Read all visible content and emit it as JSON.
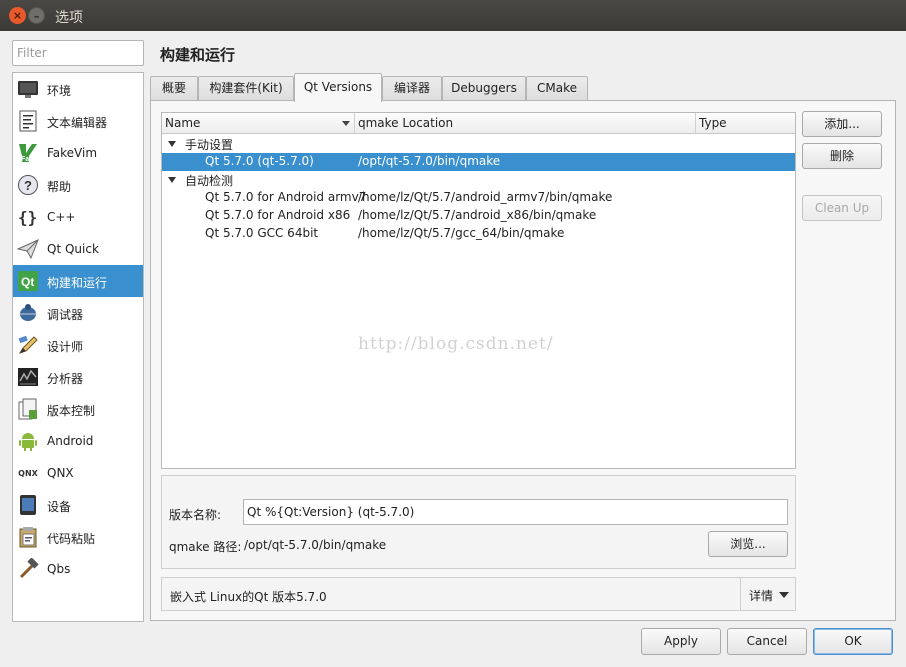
{
  "window": {
    "title": "选项",
    "close_glyph": "×",
    "minimize_glyph": "–"
  },
  "sidebar": {
    "filter_placeholder": "Filter",
    "items": [
      {
        "label": "环境",
        "icon": "monitor-icon"
      },
      {
        "label": "文本编辑器",
        "icon": "text-editor-icon"
      },
      {
        "label": "FakeVim",
        "icon": "fakevim-icon"
      },
      {
        "label": "帮助",
        "icon": "help-icon"
      },
      {
        "label": "C++",
        "icon": "braces-icon"
      },
      {
        "label": "Qt Quick",
        "icon": "paper-plane-icon"
      },
      {
        "label": "构建和运行",
        "icon": "qt-build-icon",
        "selected": true
      },
      {
        "label": "调试器",
        "icon": "bug-icon"
      },
      {
        "label": "设计师",
        "icon": "pencil-icon"
      },
      {
        "label": "分析器",
        "icon": "analyzer-icon"
      },
      {
        "label": "版本控制",
        "icon": "version-control-icon"
      },
      {
        "label": "Android",
        "icon": "android-icon"
      },
      {
        "label": "QNX",
        "icon": "qnx-icon"
      },
      {
        "label": "设备",
        "icon": "device-icon"
      },
      {
        "label": "代码粘贴",
        "icon": "code-paste-icon"
      },
      {
        "label": "Qbs",
        "icon": "hammer-icon"
      }
    ]
  },
  "main": {
    "page_title": "构建和运行",
    "tabs": [
      {
        "label": "概要"
      },
      {
        "label": "构建套件(Kit)"
      },
      {
        "label": "Qt Versions",
        "active": true
      },
      {
        "label": "编译器"
      },
      {
        "label": "Debuggers"
      },
      {
        "label": "CMake"
      }
    ],
    "table": {
      "columns": [
        "Name",
        "qmake Location",
        "Type"
      ],
      "groups": [
        {
          "label": "手动设置",
          "rows": [
            {
              "name": "Qt 5.7.0 (qt-5.7.0)",
              "location": "/opt/qt-5.7.0/bin/qmake",
              "type": "",
              "selected": true
            }
          ]
        },
        {
          "label": "自动检测",
          "rows": [
            {
              "name": "Qt 5.7.0 for Android armv7",
              "location": "/home/lz/Qt/5.7/android_armv7/bin/qmake",
              "type": ""
            },
            {
              "name": "Qt 5.7.0 for Android x86",
              "location": "/home/lz/Qt/5.7/android_x86/bin/qmake",
              "type": ""
            },
            {
              "name": "Qt 5.7.0 GCC 64bit",
              "location": "/home/lz/Qt/5.7/gcc_64/bin/qmake",
              "type": ""
            }
          ]
        }
      ]
    },
    "buttons": {
      "add": "添加...",
      "remove": "删除",
      "cleanup": "Clean Up"
    },
    "watermark": "http://blog.csdn.net/",
    "details": {
      "version_name_label": "版本名称:",
      "version_name_value": "Qt %{Qt:Version} (qt-5.7.0)",
      "qmake_path_label": "qmake 路径:",
      "qmake_path_value": "/opt/qt-5.7.0/bin/qmake",
      "browse_button": "浏览...",
      "info_text": "嵌入式 Linux的Qt 版本5.7.0",
      "details_button": "详情"
    }
  },
  "footer": {
    "apply": "Apply",
    "cancel": "Cancel",
    "ok": "OK"
  },
  "colors": {
    "selection": "#3a8fce",
    "titlebar": "#3c3b37",
    "close_button": "#e85a2b"
  }
}
